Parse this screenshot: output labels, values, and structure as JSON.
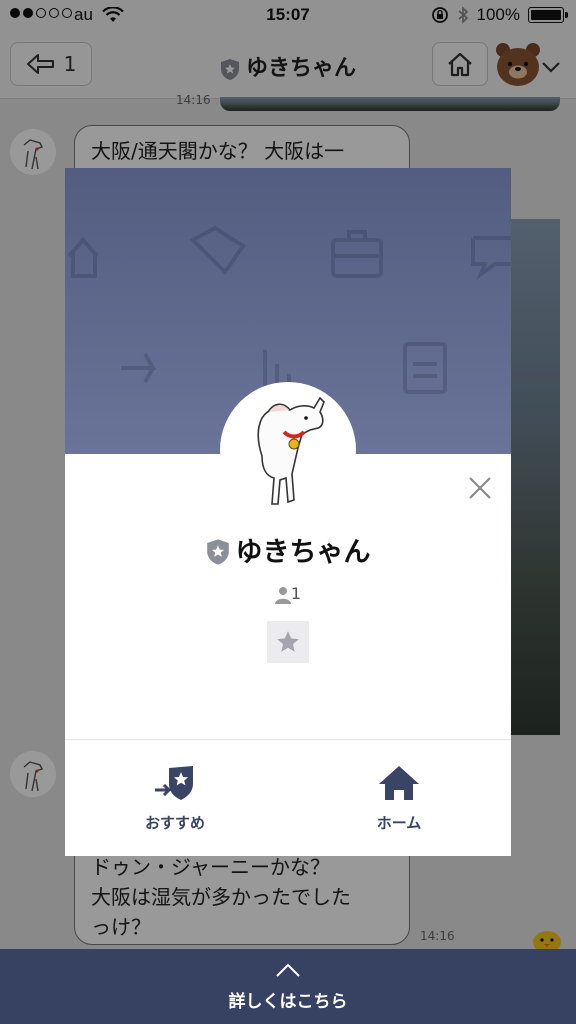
{
  "status_bar": {
    "carrier": "au",
    "time": "15:07",
    "battery": "100%"
  },
  "header": {
    "back_count": "1",
    "title": "ゆきちゃん"
  },
  "chat": {
    "top_time": "14:16",
    "message1": "大阪/通天閣かな？ 大阪は一",
    "message2_line1": "ドゥン・ジャーニーかな？",
    "message2_line2": "大阪は湿気が多かったでした",
    "message2_line3": "っけ？",
    "message2_time": "14:16"
  },
  "profile": {
    "name": "ゆきちゃん",
    "member_count": "1",
    "actions": [
      {
        "label": "おすすめ",
        "icon": "recommend-icon"
      },
      {
        "label": "ホーム",
        "icon": "home-icon"
      }
    ]
  },
  "bottom_bar": {
    "label": "詳しくはこちら"
  },
  "colors": {
    "cover": "#5d6890",
    "bottom_bar": "#374161",
    "accent": "#3a4566"
  }
}
